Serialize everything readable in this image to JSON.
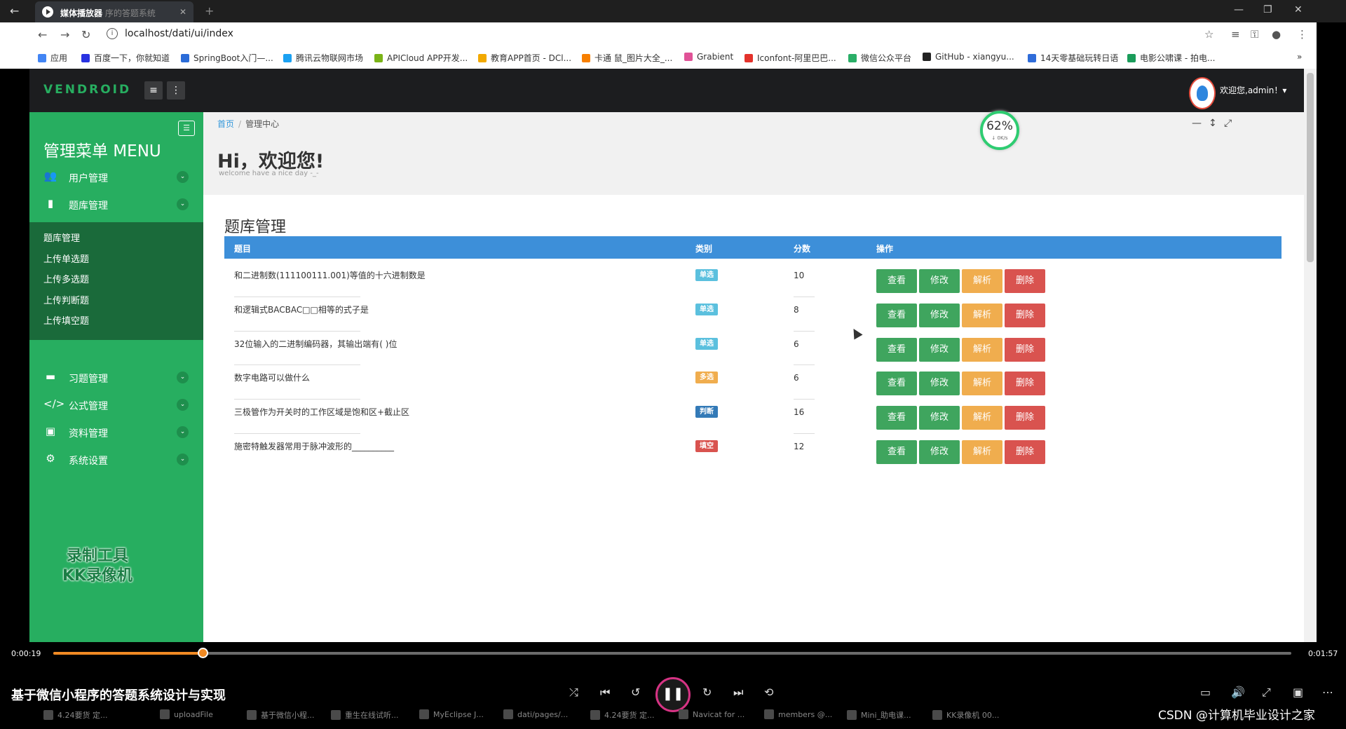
{
  "player": {
    "tab_title": "媒体播放器",
    "tab_subtitle": "序的答题系统",
    "current_time": "0:00:19",
    "total_time": "0:01:57",
    "progress": 0.121,
    "video_title": "基于微信小程序的答题系统设计与实现",
    "watermark": "CSDN @计算机毕业设计之家"
  },
  "browser": {
    "url": "localhost/dati/ui/index",
    "bookmarks": [
      {
        "label": "应用",
        "color": "#4285f4"
      },
      {
        "label": "百度一下，你就知道",
        "color": "#2932e1"
      },
      {
        "label": "SpringBoot入门—...",
        "color": "#2b6cd8"
      },
      {
        "label": "腾讯云物联网市场",
        "color": "#1ba1f2"
      },
      {
        "label": "APICloud APP开发...",
        "color": "#7ab317"
      },
      {
        "label": "教育APP首页 - DCl...",
        "color": "#f2a900"
      },
      {
        "label": "卡通 鼠_图片大全_...",
        "color": "#f77f00"
      },
      {
        "label": "Grabient",
        "color": "#e05297"
      },
      {
        "label": "Iconfont-阿里巴巴...",
        "color": "#e3322b"
      },
      {
        "label": "微信公众平台",
        "color": "#2aae67"
      },
      {
        "label": "GitHub - xiangyu...",
        "color": "#222222"
      },
      {
        "label": "14天零基础玩转日语",
        "color": "#2f6cd9"
      },
      {
        "label": "电影公啸课 - 拍电...",
        "color": "#1a9c5a"
      }
    ]
  },
  "app": {
    "logo": "VENDROID",
    "user_greeting": "欢迎您,admin！▾",
    "menu_title": "管理菜单 MENU",
    "menu": [
      {
        "label": "用户管理",
        "icon": "users-icon",
        "glyph": "👥"
      },
      {
        "label": "题库管理",
        "icon": "file-icon",
        "glyph": "▮"
      },
      {
        "label": "习题管理",
        "icon": "folder-icon",
        "glyph": "▬"
      },
      {
        "label": "公式管理",
        "icon": "code-icon",
        "glyph": "</>"
      },
      {
        "label": "资料管理",
        "icon": "excel-file-icon",
        "glyph": "▣"
      },
      {
        "label": "系统设置",
        "icon": "gears-icon",
        "glyph": "⚙"
      }
    ],
    "submenu": [
      "题库管理",
      "上传单选题",
      "上传多选题",
      "上传判断题",
      "上传填空题"
    ],
    "sidebar_overlay": [
      "录制工具",
      "KK录像机"
    ]
  },
  "header": {
    "breadcrumb_home": "首页",
    "breadcrumb_current": "管理中心",
    "greeting": "Hi，欢迎您!",
    "sub": "welcome have a nice day -_-",
    "gauge_pct": "62%",
    "gauge_speed": "↓ 0K/s"
  },
  "table": {
    "title": "题库管理",
    "columns": [
      "题目",
      "类别",
      "分数",
      "操作"
    ],
    "actions": [
      "查看",
      "修改",
      "解析",
      "删除"
    ],
    "rows": [
      {
        "question": "和二进制数(111100111.001)等值的十六进制数是",
        "type": "单选",
        "type_color": "#5bc0de",
        "score": "10"
      },
      {
        "question": "和逻辑式BACBAC□□相等的式子是",
        "type": "单选",
        "type_color": "#5bc0de",
        "score": "8"
      },
      {
        "question": "32位输入的二进制编码器，其输出端有(      )位",
        "type": "单选",
        "type_color": "#5bc0de",
        "score": "6"
      },
      {
        "question": "数字电路可以做什么",
        "type": "多选",
        "type_color": "#f0ad4e",
        "score": "6"
      },
      {
        "question": "三极管作为开关时的工作区域是饱和区+截止区",
        "type": "判断",
        "type_color": "#337ab7",
        "score": "16"
      },
      {
        "question": "施密特触发器常用于脉冲波形的__________",
        "type": "填空",
        "type_color": "#d9534f",
        "score": "12"
      }
    ]
  },
  "taskbar": [
    "4.24要货 定...",
    "uploadFile",
    "基于微信小程...",
    "重生在线试听...",
    "MyEclipse J...",
    "dati/pages/...",
    "4.24要货 定...",
    "Navicat for ...",
    "members @...",
    "Mini_助电课...",
    "KK录像机 00..."
  ]
}
